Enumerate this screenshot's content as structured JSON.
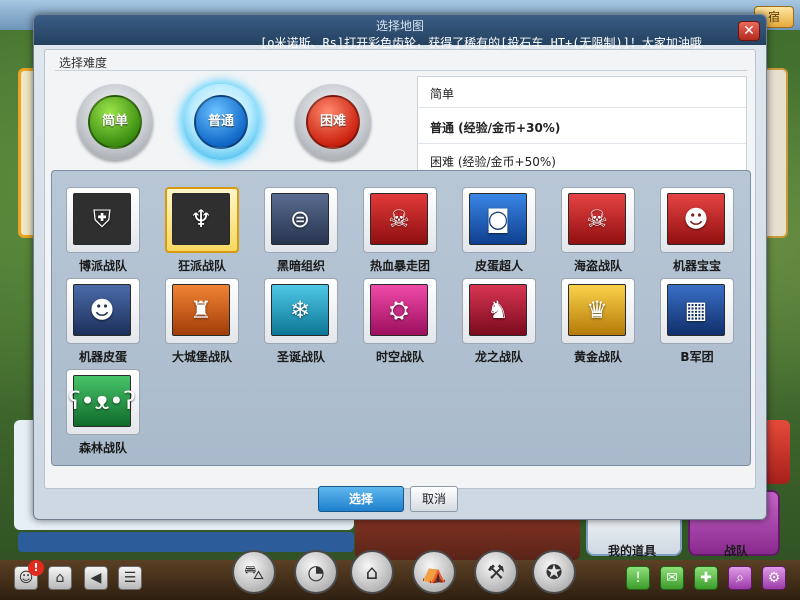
{
  "background": {
    "top_button_label": "宿",
    "items_button_label": "我的道具",
    "team_button_label": "战队",
    "notification_count": "!"
  },
  "dialog": {
    "title": "选择地图",
    "broadcast": "[o米诺斯、Rs]打开彩色齿轮，获得了稀有的[投石车 HT+(无限制)]！大家加油哦",
    "difficulty_heading": "选择难度",
    "difficulties": [
      {
        "label": "简单",
        "color": "#3d8f12",
        "selected": false
      },
      {
        "label": "普通",
        "color": "#1269c9",
        "selected": true
      },
      {
        "label": "困难",
        "color": "#cc2412",
        "selected": false
      }
    ],
    "rewards": [
      {
        "text": "简单",
        "selected": false
      },
      {
        "text": "普通 (经验/金币+30%)",
        "selected": true
      },
      {
        "text": "困难 (经验/金币+50%)",
        "selected": false
      }
    ],
    "teams": [
      {
        "name": "博派战队",
        "icon": "autobot-icon",
        "color": "#333333",
        "selected": false
      },
      {
        "name": "狂派战队",
        "icon": "decepticon-icon",
        "color": "#333333",
        "selected": true
      },
      {
        "name": "黑暗组织",
        "icon": "dark-org-icon",
        "color": "#3b4a6e",
        "selected": false
      },
      {
        "name": "热血暴走团",
        "icon": "biker-skull-icon",
        "color": "#b8191a",
        "selected": false
      },
      {
        "name": "皮蛋超人",
        "icon": "superman-robot-icon",
        "color": "#1b5fc0",
        "selected": false
      },
      {
        "name": "海盗战队",
        "icon": "pirate-skull-icon",
        "color": "#c61c1c",
        "selected": false
      },
      {
        "name": "机器宝宝",
        "icon": "robot-baby-icon",
        "color": "#c81d1d",
        "selected": false
      },
      {
        "name": "机器皮蛋",
        "icon": "robot-egg-icon",
        "color": "#2c4a86",
        "selected": false
      },
      {
        "name": "大城堡战队",
        "icon": "castle-icon",
        "color": "#d25e14",
        "selected": false
      },
      {
        "name": "圣诞战队",
        "icon": "christmas-icon",
        "color": "#1a9fbf",
        "selected": false
      },
      {
        "name": "时空战队",
        "icon": "spacetime-icon",
        "color": "#d3248a",
        "selected": false
      },
      {
        "name": "龙之战队",
        "icon": "dragon-icon",
        "color": "#b01832",
        "selected": false
      },
      {
        "name": "黄金战队",
        "icon": "golden-robot-icon",
        "color": "#e3ac14",
        "selected": false
      },
      {
        "name": "B军团",
        "icon": "city-icon",
        "color": "#1a4a94",
        "selected": false
      },
      {
        "name": "森林战队",
        "icon": "bear-icon",
        "color": "#1f9a40",
        "selected": false
      }
    ],
    "ok_label": "选择",
    "cancel_label": "取消"
  }
}
